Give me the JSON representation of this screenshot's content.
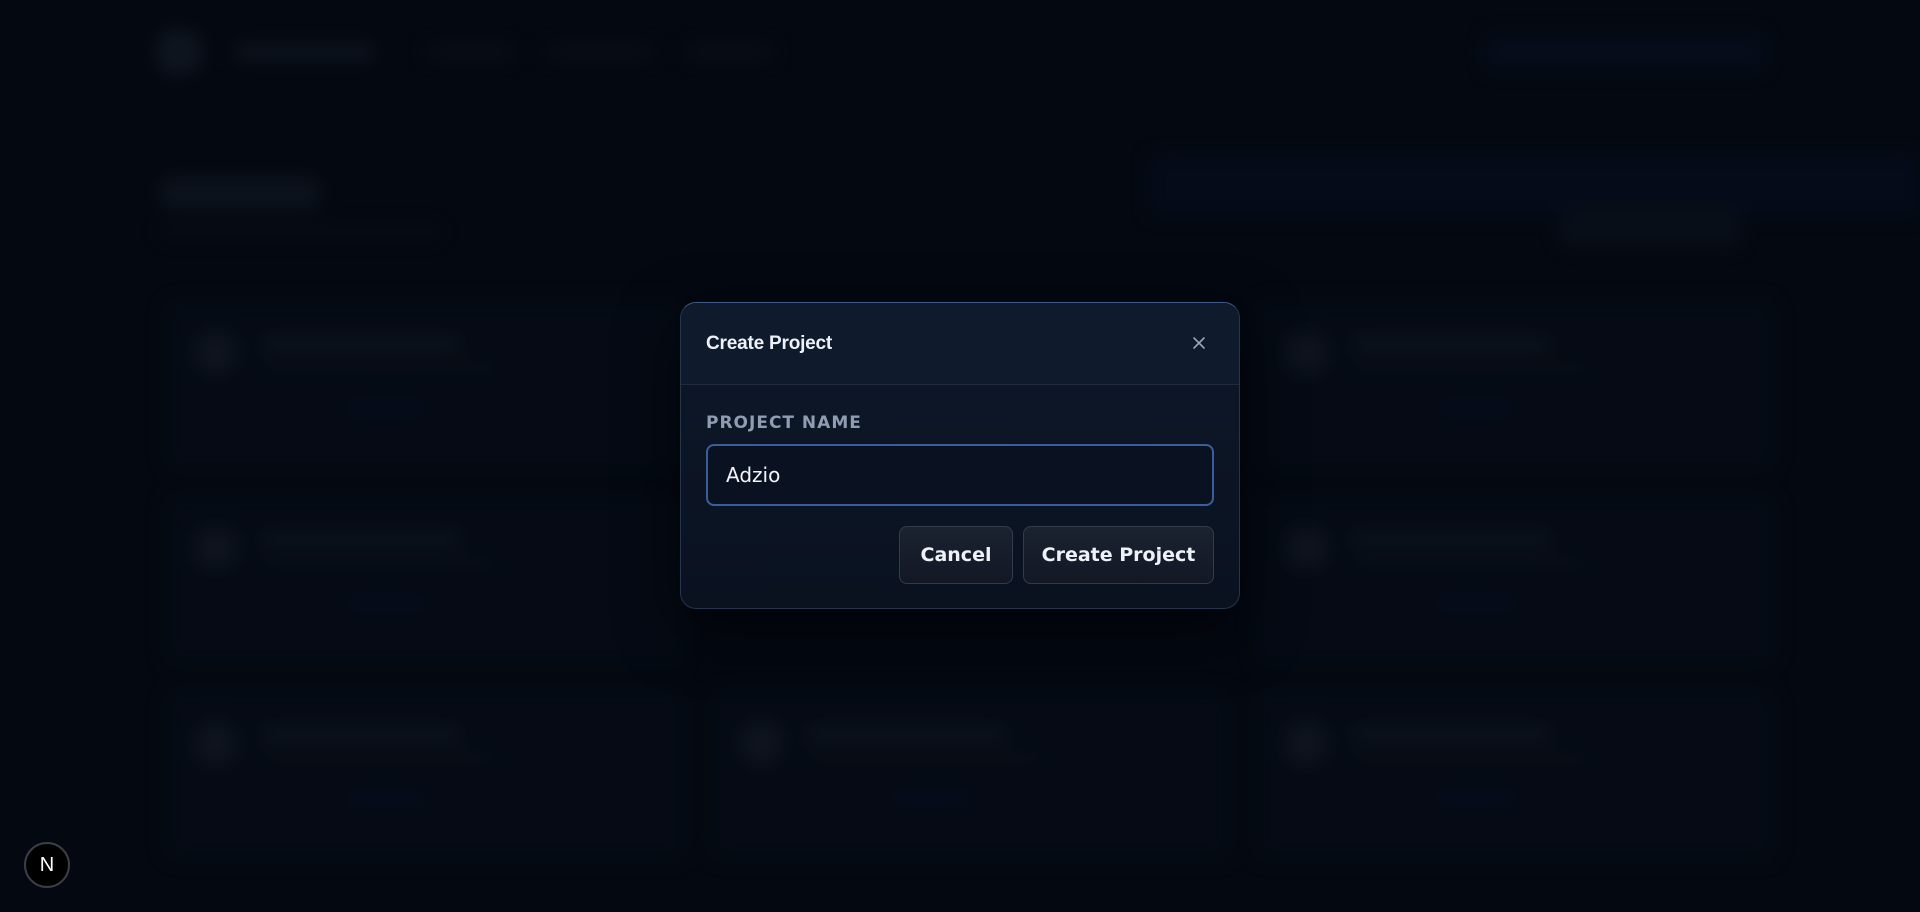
{
  "modal": {
    "title": "Create Project",
    "close_icon": "close-icon",
    "field_label": "PROJECT NAME",
    "input_value": "Adzio",
    "cancel_label": "Cancel",
    "submit_label": "Create Project"
  },
  "dev_indicator": {
    "label": "N"
  },
  "colors": {
    "background": "#050a14",
    "modal_bg": "#0e1829",
    "input_border": "#3a5e99",
    "label": "#8f9cb2",
    "text": "#eef2f8"
  }
}
